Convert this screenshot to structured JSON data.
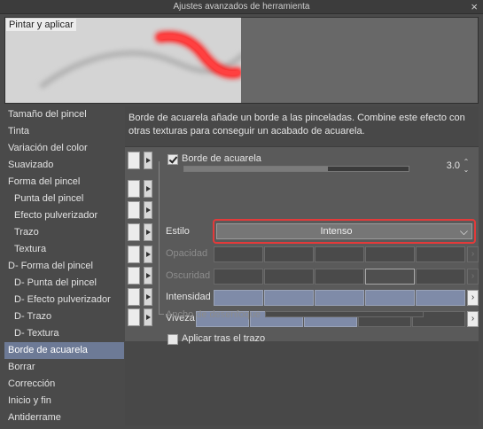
{
  "window": {
    "title": "Ajustes avanzados de herramienta"
  },
  "preview": {
    "label": "Pintar y aplicar"
  },
  "sidebar": {
    "items": [
      {
        "label": "Tamaño del pincel"
      },
      {
        "label": "Tinta"
      },
      {
        "label": "Variación del color"
      },
      {
        "label": "Suavizado"
      },
      {
        "label": "Forma del pincel"
      },
      {
        "label": "Punta del pincel"
      },
      {
        "label": "Efecto pulverizador"
      },
      {
        "label": "Trazo"
      },
      {
        "label": "Textura"
      },
      {
        "label": "D- Forma del pincel"
      },
      {
        "label": "D- Punta del pincel"
      },
      {
        "label": "D- Efecto pulverizador"
      },
      {
        "label": "D- Trazo"
      },
      {
        "label": "D- Textura"
      },
      {
        "label": "Borde de acuarela"
      },
      {
        "label": "Borrar"
      },
      {
        "label": "Corrección"
      },
      {
        "label": "Inicio y fin"
      },
      {
        "label": "Antiderrame"
      }
    ],
    "selected_label": "Borde de acuarela"
  },
  "content": {
    "description": "Borde de acuarela añade un borde a las pinceladas. Combine este efecto con otras texturas para conseguir un acabado de acuarela.",
    "watercolor_edge": {
      "label": "Borde de acuarela",
      "checked": true,
      "value": "3.0",
      "level": 0.64
    },
    "style": {
      "label": "Estilo",
      "value": "Intenso"
    },
    "opacity": {
      "label": "Opacidad",
      "enabled": false,
      "level": 0
    },
    "darkness": {
      "label": "Oscuridad",
      "enabled": false,
      "level": 0
    },
    "intensity": {
      "label": "Intensidad",
      "enabled": true,
      "level": 1.0
    },
    "vividness": {
      "label": "Viveza",
      "enabled": true,
      "level": 0.6
    },
    "apply_after_stroke": {
      "label": "Aplicar tras el trazo",
      "checked": false
    },
    "blur_width": {
      "label": "Ancho de desenfoque",
      "enabled": false
    }
  },
  "colors": {
    "accent": "#7f8ba8",
    "highlight": "#e33a3a",
    "stroke": "#ff1f1f"
  },
  "icons": {
    "close": "×",
    "chevron": "⌵",
    "spin": "⌃⌄",
    "arrow_right": "›"
  }
}
